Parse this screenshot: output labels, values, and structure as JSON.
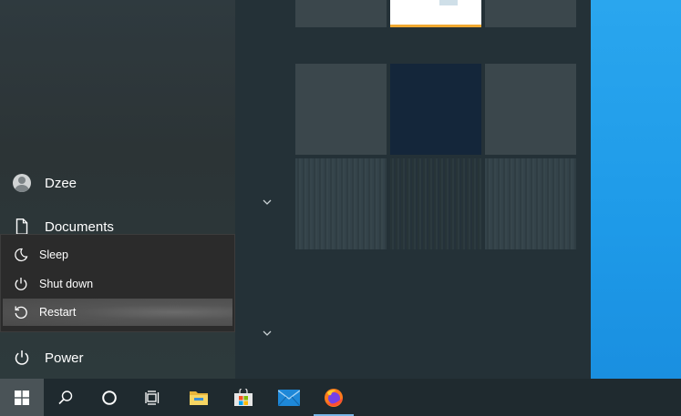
{
  "start_menu": {
    "user": {
      "name": "Dzee",
      "icon": "user-avatar-icon"
    },
    "documents": {
      "label": "Documents",
      "icon": "document-icon"
    },
    "power": {
      "label": "Power",
      "icon": "power-icon"
    },
    "power_menu": {
      "items": [
        {
          "label": "Sleep",
          "icon": "moon-icon"
        },
        {
          "label": "Shut down",
          "icon": "power-icon"
        },
        {
          "label": "Restart",
          "icon": "restart-icon"
        }
      ],
      "highlighted": "Restart"
    }
  },
  "tiles": {
    "group_toggle_icon": "chevron-down-icon"
  },
  "taskbar": {
    "items": [
      {
        "name": "start",
        "icon": "windows-logo-icon"
      },
      {
        "name": "search",
        "icon": "search-icon"
      },
      {
        "name": "cortana",
        "icon": "circle-icon"
      },
      {
        "name": "task-view",
        "icon": "task-view-icon"
      },
      {
        "name": "file-explorer",
        "icon": "folder-icon"
      },
      {
        "name": "microsoft-store",
        "icon": "store-icon"
      },
      {
        "name": "mail",
        "icon": "mail-icon"
      },
      {
        "name": "firefox",
        "icon": "firefox-icon"
      }
    ]
  },
  "colors": {
    "desktop": "#1e9ae8",
    "taskbar": "#1f2a2f",
    "flyout": "#2b2b2b",
    "tile": "#3b474c",
    "accent": "#78b4e6"
  }
}
